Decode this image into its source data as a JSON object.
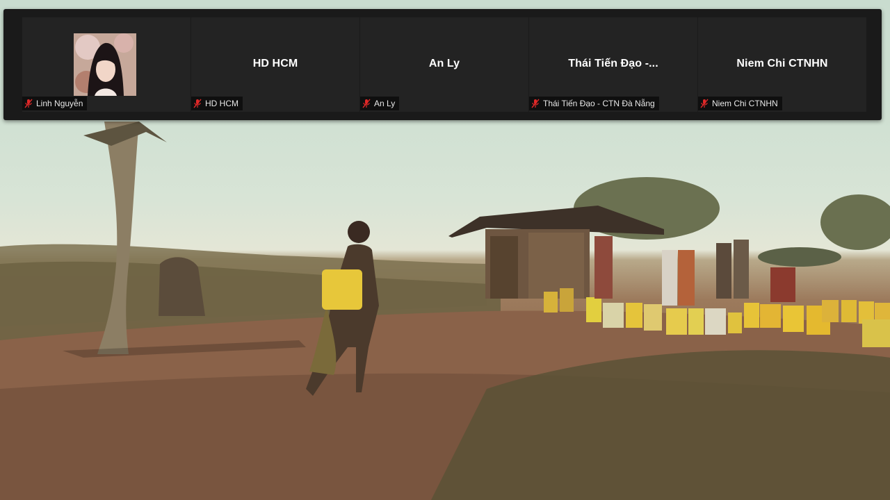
{
  "participants": [
    {
      "name": "Linh Nguyễn",
      "display": "",
      "has_photo": true,
      "muted": true
    },
    {
      "name": "HD HCM",
      "display": "HD HCM",
      "has_photo": false,
      "muted": true
    },
    {
      "name": "An Ly",
      "display": "An Ly",
      "has_photo": false,
      "muted": true
    },
    {
      "name": "Thái Tiến Đạo - CTN Đà Nẵng",
      "display": "Thái Tiến Đạo -...",
      "has_photo": false,
      "muted": true
    },
    {
      "name": "Niem Chi CTNHN",
      "display": "Niem Chi CTNHN",
      "has_photo": false,
      "muted": true
    }
  ],
  "icons": {
    "muted_mic": "mic-off-icon"
  },
  "colors": {
    "strip_bg": "#1a1a1a",
    "tile_bg": "#232323",
    "mute_red": "#e02828",
    "name_text": "#ffffff"
  }
}
